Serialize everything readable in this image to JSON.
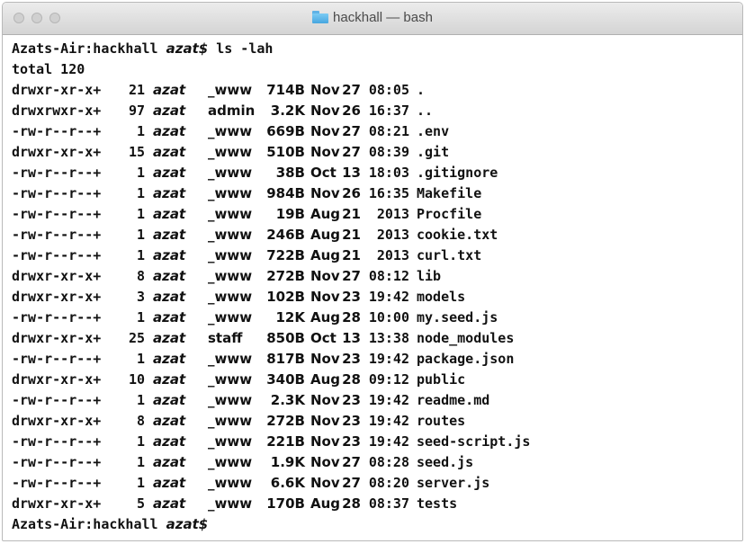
{
  "window": {
    "title": "hackhall — bash"
  },
  "terminal": {
    "prompt_host": "Azats-Air:hackhall",
    "prompt_user": "azat$",
    "command": " ls -lah",
    "total_line": "total 120",
    "rows": [
      {
        "perm": "drwxr-xr-x+",
        "links": "21",
        "owner": "azat",
        "group": "_www",
        "size": "714B",
        "month": "Nov",
        "day": "27",
        "time": "08:05",
        "name": "."
      },
      {
        "perm": "drwxrwxr-x+",
        "links": "97",
        "owner": "azat",
        "group": "admin",
        "size": "3.2K",
        "month": "Nov",
        "day": "26",
        "time": "16:37",
        "name": ".."
      },
      {
        "perm": "-rw-r--r--+",
        "links": "1",
        "owner": "azat",
        "group": "_www",
        "size": "669B",
        "month": "Nov",
        "day": "27",
        "time": "08:21",
        "name": ".env"
      },
      {
        "perm": "drwxr-xr-x+",
        "links": "15",
        "owner": "azat",
        "group": "_www",
        "size": "510B",
        "month": "Nov",
        "day": "27",
        "time": "08:39",
        "name": ".git"
      },
      {
        "perm": "-rw-r--r--+",
        "links": "1",
        "owner": "azat",
        "group": "_www",
        "size": "38B",
        "month": "Oct",
        "day": "13",
        "time": "18:03",
        "name": ".gitignore"
      },
      {
        "perm": "-rw-r--r--+",
        "links": "1",
        "owner": "azat",
        "group": "_www",
        "size": "984B",
        "month": "Nov",
        "day": "26",
        "time": "16:35",
        "name": "Makefile"
      },
      {
        "perm": "-rw-r--r--+",
        "links": "1",
        "owner": "azat",
        "group": "_www",
        "size": "19B",
        "month": "Aug",
        "day": "21",
        "time": "2013",
        "name": "Procfile"
      },
      {
        "perm": "-rw-r--r--+",
        "links": "1",
        "owner": "azat",
        "group": "_www",
        "size": "246B",
        "month": "Aug",
        "day": "21",
        "time": "2013",
        "name": "cookie.txt"
      },
      {
        "perm": "-rw-r--r--+",
        "links": "1",
        "owner": "azat",
        "group": "_www",
        "size": "722B",
        "month": "Aug",
        "day": "21",
        "time": "2013",
        "name": "curl.txt"
      },
      {
        "perm": "drwxr-xr-x+",
        "links": "8",
        "owner": "azat",
        "group": "_www",
        "size": "272B",
        "month": "Nov",
        "day": "27",
        "time": "08:12",
        "name": "lib"
      },
      {
        "perm": "drwxr-xr-x+",
        "links": "3",
        "owner": "azat",
        "group": "_www",
        "size": "102B",
        "month": "Nov",
        "day": "23",
        "time": "19:42",
        "name": "models"
      },
      {
        "perm": "-rw-r--r--+",
        "links": "1",
        "owner": "azat",
        "group": "_www",
        "size": "12K",
        "month": "Aug",
        "day": "28",
        "time": "10:00",
        "name": "my.seed.js"
      },
      {
        "perm": "drwxr-xr-x+",
        "links": "25",
        "owner": "azat",
        "group": "staff",
        "size": "850B",
        "month": "Oct",
        "day": "13",
        "time": "13:38",
        "name": "node_modules"
      },
      {
        "perm": "-rw-r--r--+",
        "links": "1",
        "owner": "azat",
        "group": "_www",
        "size": "817B",
        "month": "Nov",
        "day": "23",
        "time": "19:42",
        "name": "package.json"
      },
      {
        "perm": "drwxr-xr-x+",
        "links": "10",
        "owner": "azat",
        "group": "_www",
        "size": "340B",
        "month": "Aug",
        "day": "28",
        "time": "09:12",
        "name": "public"
      },
      {
        "perm": "-rw-r--r--+",
        "links": "1",
        "owner": "azat",
        "group": "_www",
        "size": "2.3K",
        "month": "Nov",
        "day": "23",
        "time": "19:42",
        "name": "readme.md"
      },
      {
        "perm": "drwxr-xr-x+",
        "links": "8",
        "owner": "azat",
        "group": "_www",
        "size": "272B",
        "month": "Nov",
        "day": "23",
        "time": "19:42",
        "name": "routes"
      },
      {
        "perm": "-rw-r--r--+",
        "links": "1",
        "owner": "azat",
        "group": "_www",
        "size": "221B",
        "month": "Nov",
        "day": "23",
        "time": "19:42",
        "name": "seed-script.js"
      },
      {
        "perm": "-rw-r--r--+",
        "links": "1",
        "owner": "azat",
        "group": "_www",
        "size": "1.9K",
        "month": "Nov",
        "day": "27",
        "time": "08:28",
        "name": "seed.js"
      },
      {
        "perm": "-rw-r--r--+",
        "links": "1",
        "owner": "azat",
        "group": "_www",
        "size": "6.6K",
        "month": "Nov",
        "day": "27",
        "time": "08:20",
        "name": "server.js"
      },
      {
        "perm": "drwxr-xr-x+",
        "links": "5",
        "owner": "azat",
        "group": "_www",
        "size": "170B",
        "month": "Aug",
        "day": "28",
        "time": "08:37",
        "name": "tests"
      }
    ]
  },
  "colors": {
    "traffic_light": "#d0d0d0",
    "folder_icon": "#5fb2e6",
    "text": "#111111"
  }
}
